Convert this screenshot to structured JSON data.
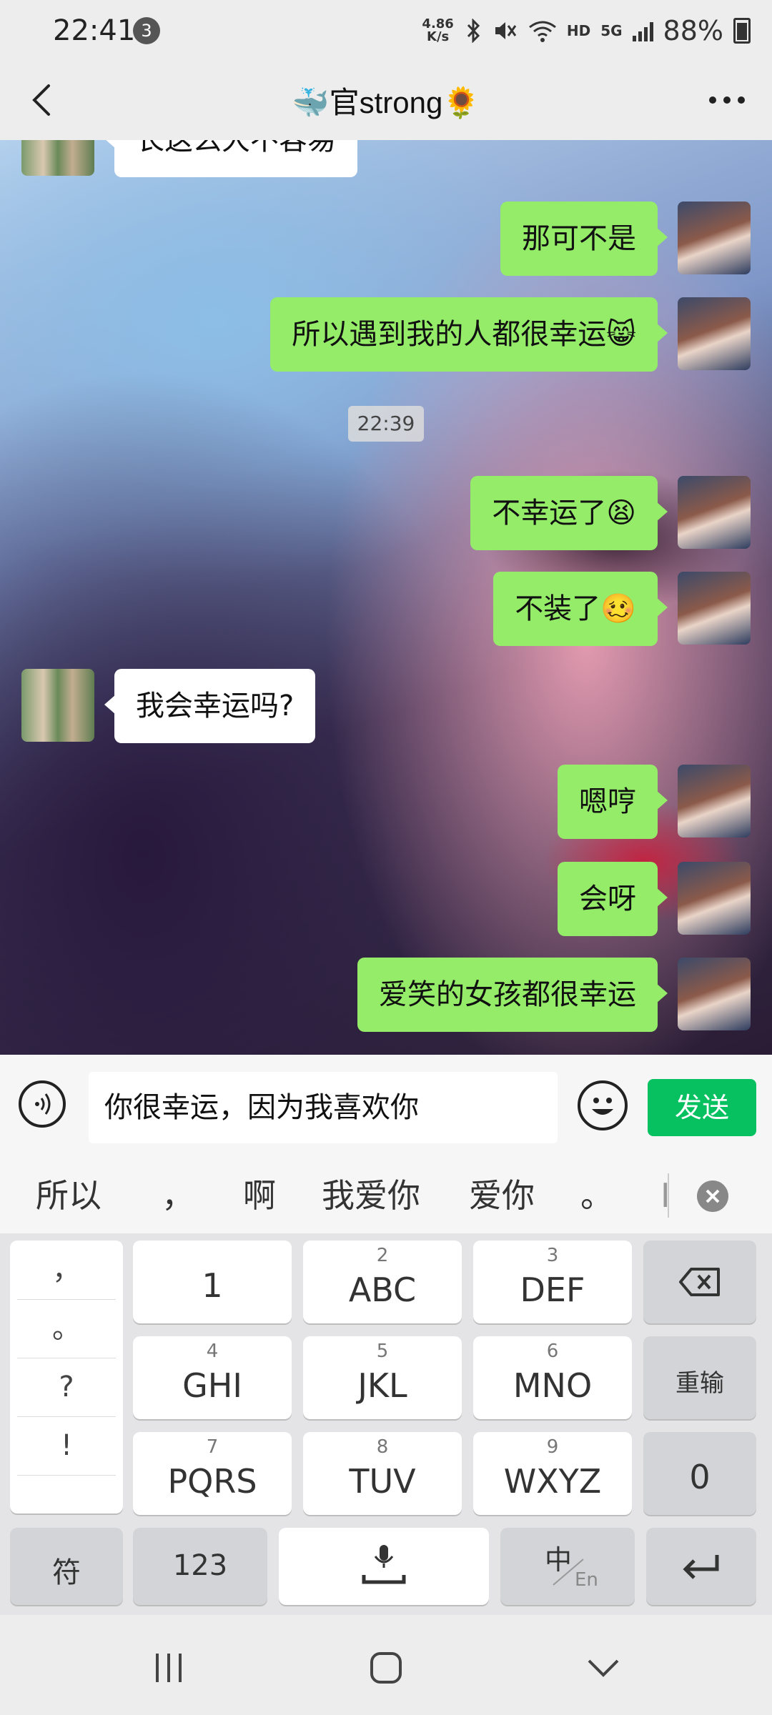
{
  "status_bar": {
    "time": "22:41",
    "notification_count": "3",
    "net_speed_value": "4.86",
    "net_speed_unit": "K/s",
    "hd_label": "HD",
    "network_label": "5G",
    "battery_percent": "88%",
    "icons": [
      "bluetooth-icon",
      "mute-icon",
      "wifi-icon",
      "signal-icon",
      "battery-icon"
    ]
  },
  "nav": {
    "title": "🐳官strong🌻",
    "back_icon": "back-arrow-icon",
    "more_icon": "more-icon"
  },
  "chat": {
    "messages": [
      {
        "side": "other",
        "text": "长这么大不容易"
      },
      {
        "side": "me",
        "text": "那可不是"
      },
      {
        "side": "me",
        "text": "所以遇到我的人都很幸运😸"
      },
      {
        "side": "me",
        "text": "不幸运了😫"
      },
      {
        "side": "me",
        "text": "不装了🥴"
      },
      {
        "side": "other",
        "text": "我会幸运吗?"
      },
      {
        "side": "me",
        "text": "嗯哼"
      },
      {
        "side": "me",
        "text": "会呀"
      },
      {
        "side": "me",
        "text": "爱笑的女孩都很幸运"
      }
    ],
    "timestamp": "22:39"
  },
  "input_bar": {
    "text": "你很幸运，因为我喜欢你",
    "send_label": "发送",
    "voice_icon": "voice-icon",
    "emoji_icon": "emoji-icon"
  },
  "candidates": [
    "所以",
    "，",
    "啊",
    "我爱你",
    "爱你",
    "。",
    "I"
  ],
  "keyboard": {
    "symbols": [
      "，",
      "。",
      "?",
      "!"
    ],
    "rows": [
      [
        {
          "num": "",
          "label": "1"
        },
        {
          "num": "2",
          "label": "ABC"
        },
        {
          "num": "3",
          "label": "DEF"
        }
      ],
      [
        {
          "num": "4",
          "label": "GHI"
        },
        {
          "num": "5",
          "label": "JKL"
        },
        {
          "num": "6",
          "label": "MNO"
        }
      ],
      [
        {
          "num": "7",
          "label": "PQRS"
        },
        {
          "num": "8",
          "label": "TUV"
        },
        {
          "num": "9",
          "label": "WXYZ"
        }
      ]
    ],
    "reenter_label": "重输",
    "zero_label": "0",
    "symbol_label": "符",
    "num_label": "123",
    "lang_main": "中",
    "lang_sub": "En",
    "backspace_icon": "backspace-icon",
    "space_icon": "space-mic-icon",
    "enter_icon": "enter-icon"
  },
  "system_nav": [
    "recents-icon",
    "home-icon",
    "back-chevron-icon"
  ]
}
